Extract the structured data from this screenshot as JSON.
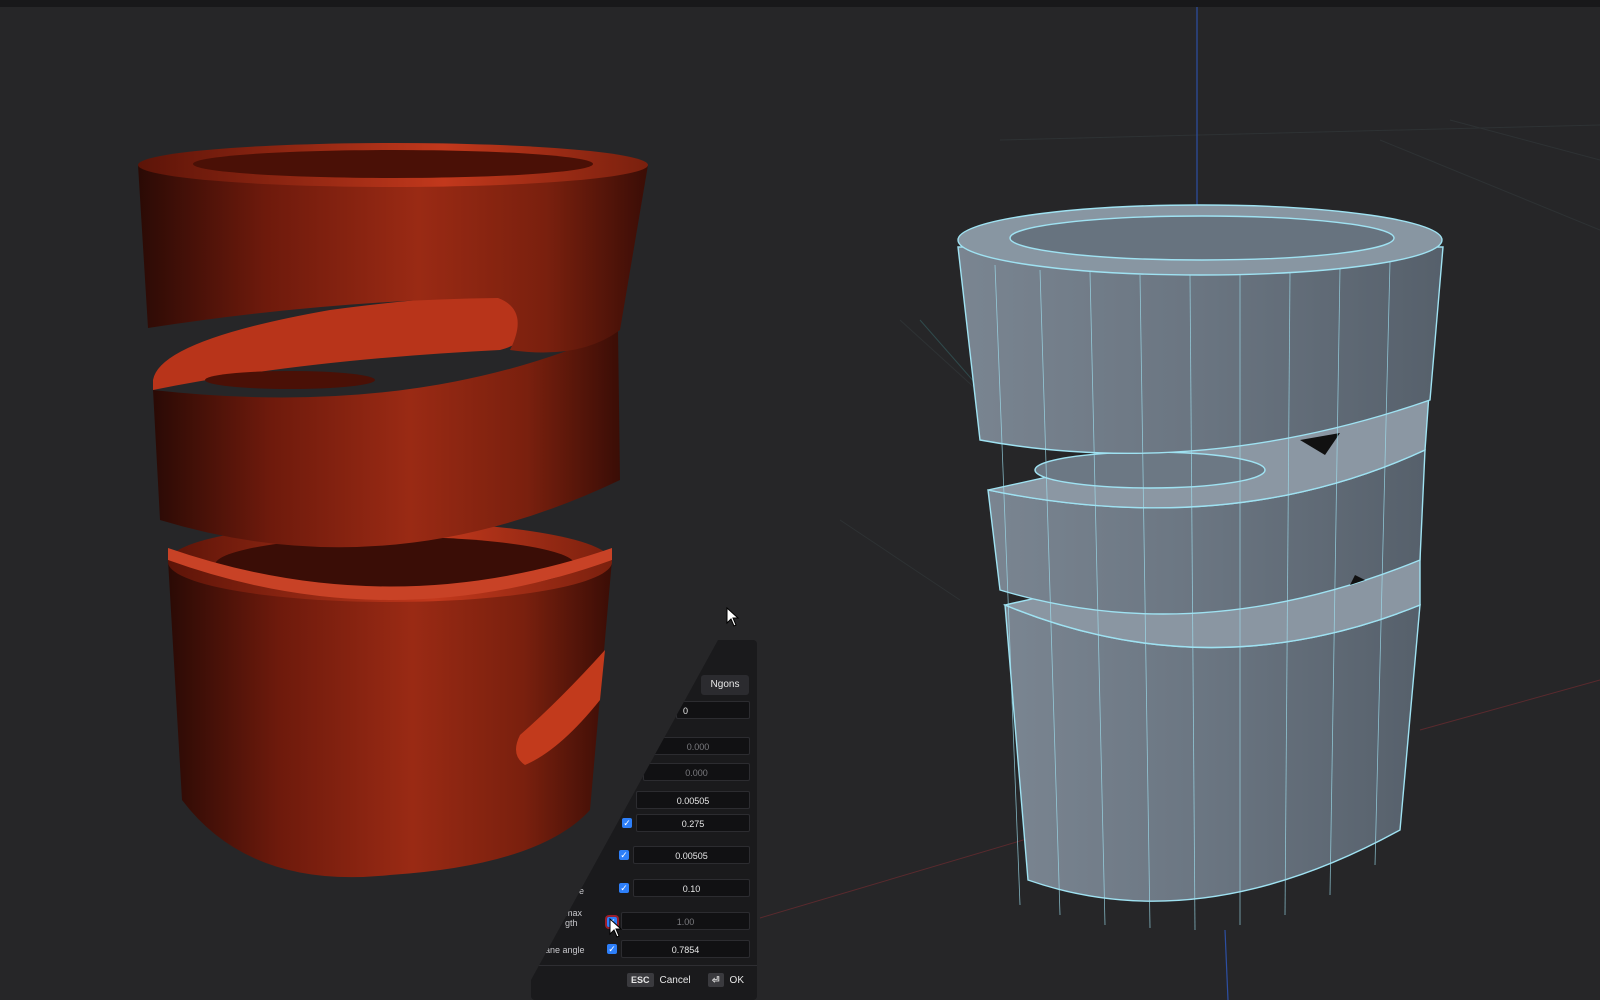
{
  "dialog": {
    "mode_button": "Ngons",
    "partial_value": "0",
    "rows": [
      {
        "value": "0.000",
        "dimmed": true
      },
      {
        "value": "0.000",
        "dimmed": true
      },
      {
        "value": "0.00505"
      },
      {
        "value": "0.275",
        "checked": true
      },
      {
        "value": "0.00505",
        "checked": true
      },
      {
        "value": "0.10",
        "checked": true,
        "label": "e\ne"
      },
      {
        "value": "1.00",
        "dimmed": true,
        "checked": true,
        "label": "max\ngth"
      },
      {
        "value": "0.7854",
        "checked": true,
        "label": "lane angle"
      }
    ],
    "cancel": {
      "key": "ESC",
      "label": "Cancel"
    },
    "ok": {
      "key": "⏎",
      "label": "OK"
    }
  },
  "colors": {
    "background": "#262628",
    "solid_mesh": "#a32a12",
    "wire_mesh_fill": "#65717d",
    "wire_edges": "#9fe2f2",
    "checkbox": "#2d7ff9"
  },
  "icons": [
    "mouse-cursor-icon",
    "check-icon",
    "enter-key-icon"
  ]
}
